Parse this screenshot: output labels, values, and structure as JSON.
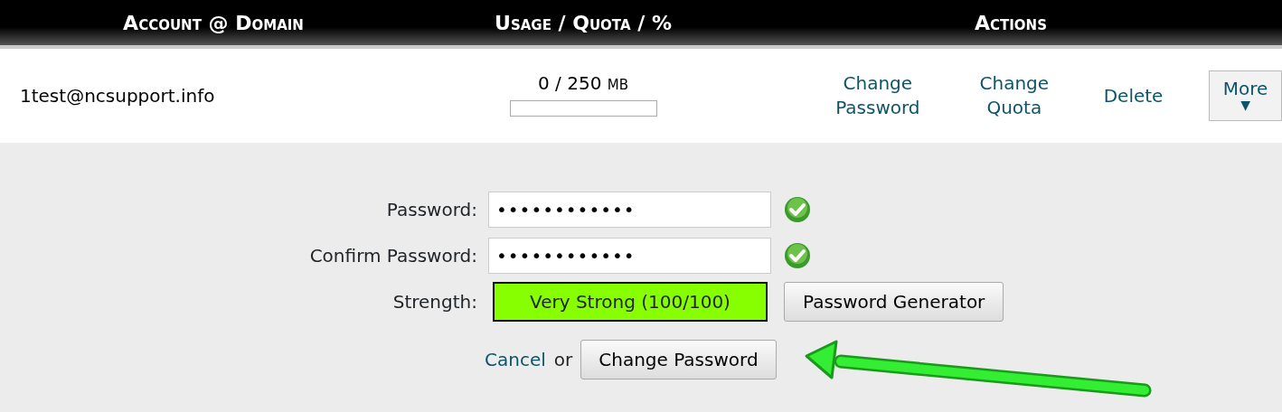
{
  "table": {
    "columns": [
      "Account @ Domain",
      "Usage / Quota / %",
      "Actions"
    ],
    "rows": [
      {
        "account": "1test@ncsupport.info",
        "usage": "0 / 250",
        "unit": "MB",
        "level": 0,
        "actions": [
          {
            "kind": "link",
            "label": [
              "Change",
              "Password"
            ]
          },
          {
            "kind": "link",
            "label": [
              "Change",
              "Quota"
            ]
          },
          {
            "kind": "link",
            "label": [
              "Delete"
            ]
          },
          {
            "kind": "menu",
            "label": [
              "More"
            ],
            "caret": "▼"
          }
        ]
      }
    ]
  },
  "form": {
    "fields": [
      {
        "label": "Password:",
        "value": "••••••••••••",
        "valid": true
      },
      {
        "label": "Confirm Password:",
        "value": "••••••••••••",
        "valid": true
      }
    ],
    "strength": {
      "label": "Strength:",
      "text": "Very Strong (100/100)",
      "level": 1
    },
    "generator_button": "Password Generator",
    "cancel": "Cancel",
    "or": "or",
    "submit": "Change Password"
  },
  "annotation": {
    "kind": "arrow"
  }
}
